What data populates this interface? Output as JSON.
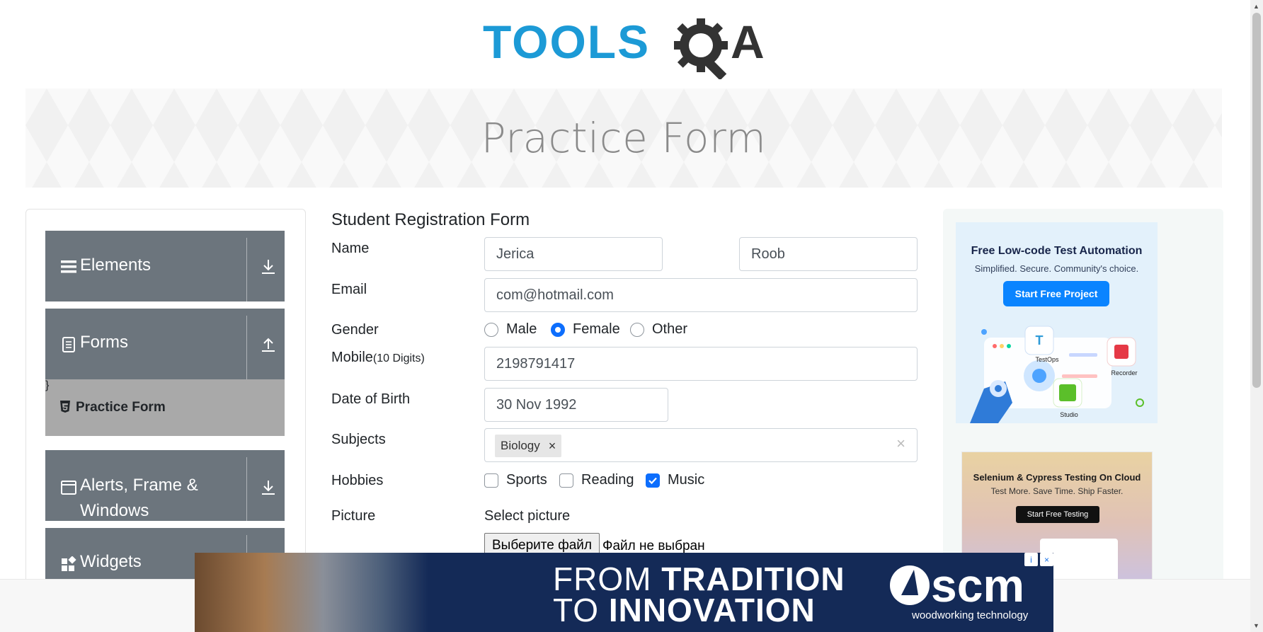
{
  "logo": {
    "text_left": "TOOLS",
    "text_right": "A",
    "color_blue": "#1c9ad6",
    "color_dark": "#333333"
  },
  "banner": {
    "title": "Practice Form"
  },
  "sidebar": {
    "groups": [
      {
        "label": "Elements",
        "icon": "menu-icon",
        "arrow": "download-arrow-icon"
      },
      {
        "label": "Forms",
        "icon": "document-icon",
        "arrow": "upload-arrow-icon"
      },
      {
        "label": "Alerts, Frame &",
        "label_line2": "Windows",
        "icon": "window-icon",
        "arrow": "download-arrow-icon"
      },
      {
        "label": "Widgets",
        "icon": "widgets-icon"
      }
    ],
    "active_item": {
      "label": "Practice Form",
      "icon": "html5-icon"
    }
  },
  "form": {
    "title": "Student Registration Form",
    "labels": {
      "name": "Name",
      "email": "Email",
      "gender": "Gender",
      "mobile": "Mobile",
      "mobile_hint": "(10 Digits)",
      "dob": "Date of Birth",
      "subjects": "Subjects",
      "hobbies": "Hobbies",
      "picture": "Picture"
    },
    "first_name": "Jerica",
    "last_name": "Roob",
    "email": "com@hotmail.com",
    "gender_options": [
      {
        "label": "Male",
        "checked": false
      },
      {
        "label": "Female",
        "checked": true
      },
      {
        "label": "Other",
        "checked": false
      }
    ],
    "mobile": "2198791417",
    "dob": "30 Nov 1992",
    "subjects": [
      {
        "label": "Biology",
        "remove": "×"
      }
    ],
    "subjects_clear": "×",
    "hobbies": [
      {
        "label": "Sports",
        "checked": false
      },
      {
        "label": "Reading",
        "checked": false
      },
      {
        "label": "Music",
        "checked": true
      }
    ],
    "select_picture": "Select picture",
    "file_button": "Выберите файл",
    "file_status": "Файл не выбран",
    "accent": "#0d6efd"
  },
  "ads": {
    "right1": {
      "headline": "Free Low-code Test Automation",
      "subline": "Simplified. Secure. Community's choice.",
      "button": "Start Free Project",
      "labels": [
        "TestOps",
        "Recorder",
        "Studio"
      ]
    },
    "right2": {
      "headline": "Selenium & Cypress Testing On Cloud",
      "subline": "Test More. Save Time. Ship Faster.",
      "button": "Start Free Testing"
    },
    "bottom": {
      "line1_light": "FROM ",
      "line1_bold": "TRADITION",
      "line2_light": "TO ",
      "line2_bold": "INNOVATION",
      "brand": "scm",
      "tagline": "woodworking technology",
      "info_icon": "i",
      "close_icon": "×"
    }
  }
}
